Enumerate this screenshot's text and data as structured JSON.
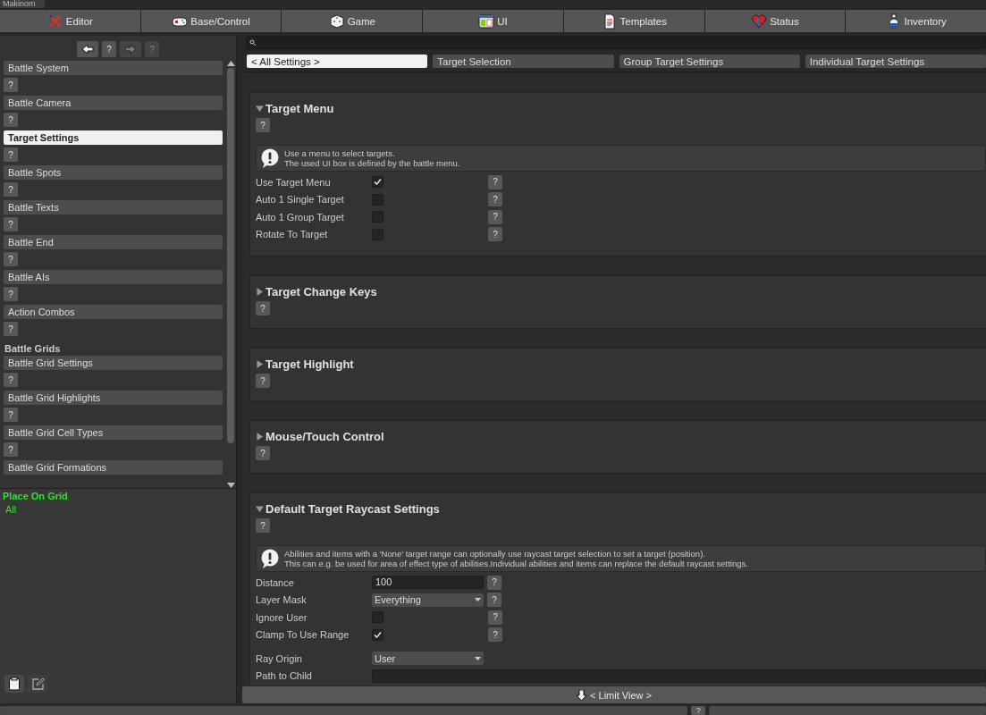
{
  "window": {
    "title": "Makinom"
  },
  "main_tabs": [
    {
      "label": "Editor",
      "selected": false
    },
    {
      "label": "Base/Control",
      "selected": false
    },
    {
      "label": "Game",
      "selected": false
    },
    {
      "label": "UI",
      "selected": false
    },
    {
      "label": "Templates",
      "selected": false
    },
    {
      "label": "Status",
      "selected": false
    },
    {
      "label": "Inventory",
      "selected": false
    }
  ],
  "nav_buttons": [
    {
      "kind": "back",
      "disabled": false
    },
    {
      "kind": "help",
      "label": "?",
      "disabled": false
    },
    {
      "kind": "forward",
      "disabled": true
    },
    {
      "kind": "help",
      "label": "?",
      "disabled": true
    }
  ],
  "sidebar": {
    "items": [
      {
        "kind": "item",
        "label": "Battle System",
        "selected": false,
        "help": "?"
      },
      {
        "kind": "item",
        "label": "Battle Camera",
        "selected": false,
        "help": "?"
      },
      {
        "kind": "item",
        "label": "Target Settings",
        "selected": true,
        "help": "?"
      },
      {
        "kind": "item",
        "label": "Battle Spots",
        "selected": false,
        "help": "?"
      },
      {
        "kind": "item",
        "label": "Battle Texts",
        "selected": false,
        "help": "?"
      },
      {
        "kind": "item",
        "label": "Battle End",
        "selected": false,
        "help": "?"
      },
      {
        "kind": "item",
        "label": "Battle AIs",
        "selected": false,
        "help": "?"
      },
      {
        "kind": "item",
        "label": "Action Combos",
        "selected": false,
        "help": "?"
      },
      {
        "kind": "header",
        "label": "Battle Grids"
      },
      {
        "kind": "item",
        "label": "Battle Grid Settings",
        "selected": false,
        "help": "?"
      },
      {
        "kind": "item",
        "label": "Battle Grid Highlights",
        "selected": false,
        "help": "?"
      },
      {
        "kind": "item",
        "label": "Battle Grid Cell Types",
        "selected": false,
        "help": "?"
      },
      {
        "kind": "item",
        "label": "Battle Grid Formations",
        "selected": false
      }
    ]
  },
  "filter": {
    "title": "Place On Grid",
    "value": "All"
  },
  "section_tabs": [
    {
      "label": "< All Settings >",
      "selected": true
    },
    {
      "label": "Target Selection",
      "selected": false
    },
    {
      "label": "Group Target Settings",
      "selected": false
    },
    {
      "label": "Individual Target Settings",
      "selected": false
    }
  ],
  "sections": [
    {
      "title": "Target Menu",
      "expanded": true,
      "help": "?",
      "info": [
        "Use a menu to select targets.",
        "The used UI box is defined by the battle menu."
      ],
      "rows": [
        {
          "kind": "checkbox",
          "label": "Use Target Menu",
          "checked": true,
          "help": "?"
        },
        {
          "kind": "checkbox",
          "label": "Auto 1 Single Target",
          "checked": false,
          "help": "?"
        },
        {
          "kind": "checkbox",
          "label": "Auto 1 Group Target",
          "checked": false,
          "help": "?"
        },
        {
          "kind": "checkbox",
          "label": "Rotate To Target",
          "checked": false,
          "help": "?"
        }
      ]
    },
    {
      "title": "Target Change Keys",
      "expanded": false,
      "help": "?"
    },
    {
      "title": "Target Highlight",
      "expanded": false,
      "help": "?"
    },
    {
      "title": "Mouse/Touch Control",
      "expanded": false,
      "help": "?"
    },
    {
      "title": "Default Target Raycast Settings",
      "expanded": true,
      "help": "?",
      "info": [
        "Abilities and items with a 'None' target range can optionally use raycast target selection to set a target (position).",
        "This can e.g. be used for area of effect type of abilities.Individual abilities and items can replace the default raycast settings."
      ],
      "rows": [
        {
          "kind": "text",
          "label": "Distance",
          "value": "100",
          "help": "?"
        },
        {
          "kind": "dropdown",
          "label": "Layer Mask",
          "value": "Everything",
          "help": "?"
        },
        {
          "kind": "checkbox",
          "label": "Ignore User",
          "checked": false,
          "help": "?"
        },
        {
          "kind": "checkbox",
          "label": "Clamp To Use Range",
          "checked": true,
          "help": "?"
        },
        {
          "kind": "gap"
        },
        {
          "kind": "dropdown",
          "label": "Ray Origin",
          "value": "User"
        },
        {
          "kind": "wide_text",
          "label": "Path to Child"
        }
      ]
    }
  ],
  "limit_view": {
    "label": "< Limit View >"
  },
  "status_bar": {
    "help": "?"
  }
}
